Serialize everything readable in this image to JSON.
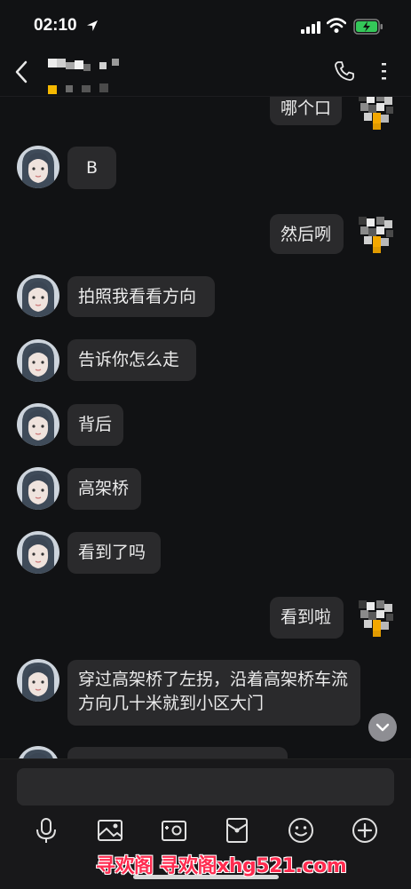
{
  "status_bar": {
    "time": "02:10"
  },
  "messages": [
    {
      "side": "right",
      "text": "哪个口"
    },
    {
      "side": "left",
      "text": "B"
    },
    {
      "side": "right",
      "text": "然后咧"
    },
    {
      "side": "left",
      "text": "拍照我看看方向"
    },
    {
      "side": "left",
      "text": "告诉你怎么走"
    },
    {
      "side": "left",
      "text": "背后"
    },
    {
      "side": "left",
      "text": "高架桥"
    },
    {
      "side": "left",
      "text": "看到了吗"
    },
    {
      "side": "right",
      "text": "看到啦"
    },
    {
      "side": "left",
      "text": "穿过高架桥了左拐，沿着高架桥车流方向几十米就到小区大门"
    }
  ],
  "watermark": {
    "text": "寻欢阁 寻欢阁xhg521.com"
  },
  "colors": {
    "background": "#111214",
    "bubble": "#2a2a2c",
    "watermark": "#ff2b4f"
  },
  "icons": [
    "back-icon",
    "phone-icon",
    "more-icon",
    "microphone-icon",
    "image-icon",
    "camera-icon",
    "red-envelope-icon",
    "emoji-icon",
    "plus-icon",
    "chevron-down-icon"
  ]
}
